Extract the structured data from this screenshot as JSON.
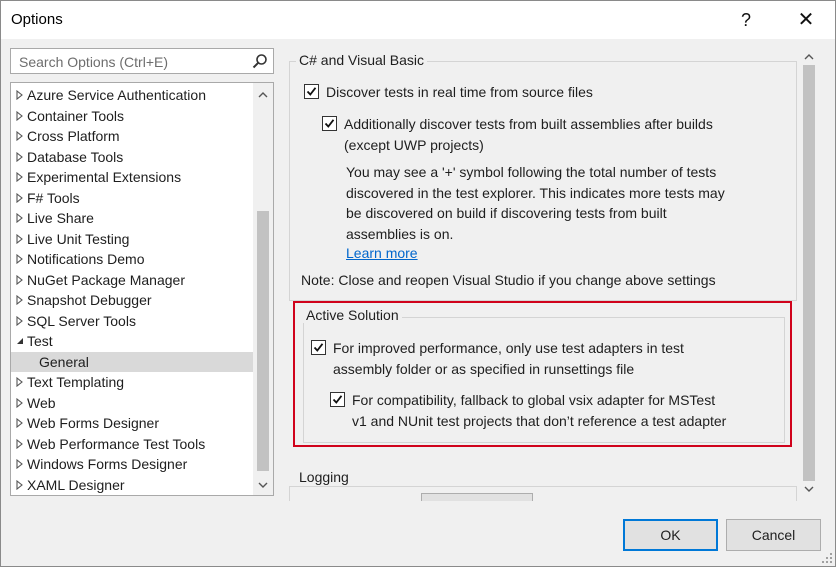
{
  "window": {
    "title": "Options",
    "help_glyph": "?",
    "close_glyph": "✕"
  },
  "search": {
    "placeholder": "Search Options (Ctrl+E)",
    "value": ""
  },
  "tree": {
    "items": [
      {
        "label": "Azure Service Authentication",
        "expanded": false
      },
      {
        "label": "Container Tools",
        "expanded": false
      },
      {
        "label": "Cross Platform",
        "expanded": false
      },
      {
        "label": "Database Tools",
        "expanded": false
      },
      {
        "label": "Experimental Extensions",
        "expanded": false
      },
      {
        "label": "F# Tools",
        "expanded": false
      },
      {
        "label": "Live Share",
        "expanded": false
      },
      {
        "label": "Live Unit Testing",
        "expanded": false
      },
      {
        "label": "Notifications Demo",
        "expanded": false
      },
      {
        "label": "NuGet Package Manager",
        "expanded": false
      },
      {
        "label": "Snapshot Debugger",
        "expanded": false
      },
      {
        "label": "SQL Server Tools",
        "expanded": false
      },
      {
        "label": "Test",
        "expanded": true
      },
      {
        "label": "General",
        "child": true,
        "selected": true
      },
      {
        "label": "Text Templating",
        "expanded": false
      },
      {
        "label": "Web",
        "expanded": false
      },
      {
        "label": "Web Forms Designer",
        "expanded": false
      },
      {
        "label": "Web Performance Test Tools",
        "expanded": false
      },
      {
        "label": "Windows Forms Designer",
        "expanded": false
      },
      {
        "label": "XAML Designer",
        "expanded": false
      }
    ]
  },
  "csharp_vb": {
    "title": "C# and Visual Basic",
    "discover_realtime": {
      "label": "Discover tests in real time from source files",
      "checked": true
    },
    "discover_built": {
      "line1": "Additionally discover tests from built assemblies after builds",
      "line2": "(except UWP projects)",
      "checked": true
    },
    "info_lines": [
      "You may see a '+' symbol following the total number of tests",
      "discovered in the test explorer. This indicates more tests may",
      "be discovered on build if discovering tests from built",
      "assemblies is on."
    ],
    "learn_more": "Learn more",
    "note": "Note: Close and reopen Visual Studio if you change above settings"
  },
  "active_solution": {
    "title": "Active Solution",
    "improved_perf": {
      "line1": "For improved performance, only use test adapters in test",
      "line2": "assembly folder or as specified in runsettings file",
      "checked": true
    },
    "fallback": {
      "line1": "For compatibility, fallback to global vsix adapter for MSTest",
      "line2": "v1 and NUnit test projects that don’t reference a test adapter",
      "checked": true
    }
  },
  "logging": {
    "title": "Logging"
  },
  "footer": {
    "ok_label": "OK",
    "cancel_label": "Cancel"
  },
  "colors": {
    "highlight_border": "#d0021b",
    "link": "#0066cc",
    "ok_border": "#0078d7",
    "selected_row": "#d9d9d9"
  }
}
